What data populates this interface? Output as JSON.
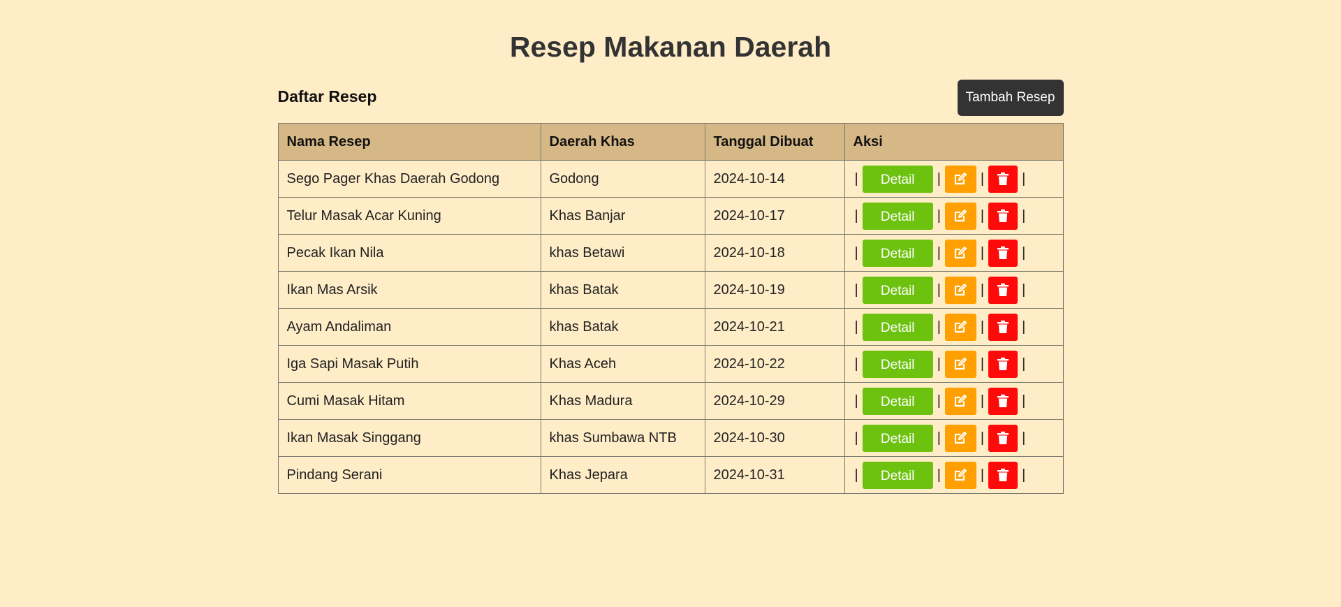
{
  "page": {
    "title": "Resep Makanan Daerah"
  },
  "toolbar": {
    "section_title": "Daftar Resep",
    "add_label": "Tambah Resep"
  },
  "table": {
    "headers": [
      "Nama Resep",
      "Daerah Khas",
      "Tanggal Dibuat",
      "Aksi"
    ],
    "rows": [
      {
        "name": "Sego Pager Khas Daerah Godong",
        "region": "Godong",
        "date": "2024-10-14"
      },
      {
        "name": "Telur Masak Acar Kuning",
        "region": "Khas Banjar",
        "date": "2024-10-17"
      },
      {
        "name": "Pecak Ikan Nila",
        "region": "khas Betawi",
        "date": "2024-10-18"
      },
      {
        "name": "Ikan Mas Arsik",
        "region": "khas Batak",
        "date": "2024-10-19"
      },
      {
        "name": "Ayam Andaliman",
        "region": "khas Batak",
        "date": "2024-10-21"
      },
      {
        "name": "Iga Sapi Masak Putih",
        "region": "Khas Aceh",
        "date": "2024-10-22"
      },
      {
        "name": "Cumi Masak Hitam",
        "region": "Khas Madura",
        "date": "2024-10-29"
      },
      {
        "name": "Ikan Masak Singgang",
        "region": "khas Sumbawa NTB",
        "date": "2024-10-30"
      },
      {
        "name": "Pindang Serani",
        "region": "Khas Jepara",
        "date": "2024-10-31"
      }
    ],
    "actions": {
      "detail_label": "Detail",
      "separator": "|",
      "edit_icon": "edit-icon",
      "delete_icon": "trash-icon"
    }
  },
  "colors": {
    "background": "#ffedc7",
    "header_bg": "#d6b886",
    "detail": "#6cc20e",
    "edit": "#ff9f00",
    "delete": "#ff0a0a",
    "add_button": "#333333"
  }
}
